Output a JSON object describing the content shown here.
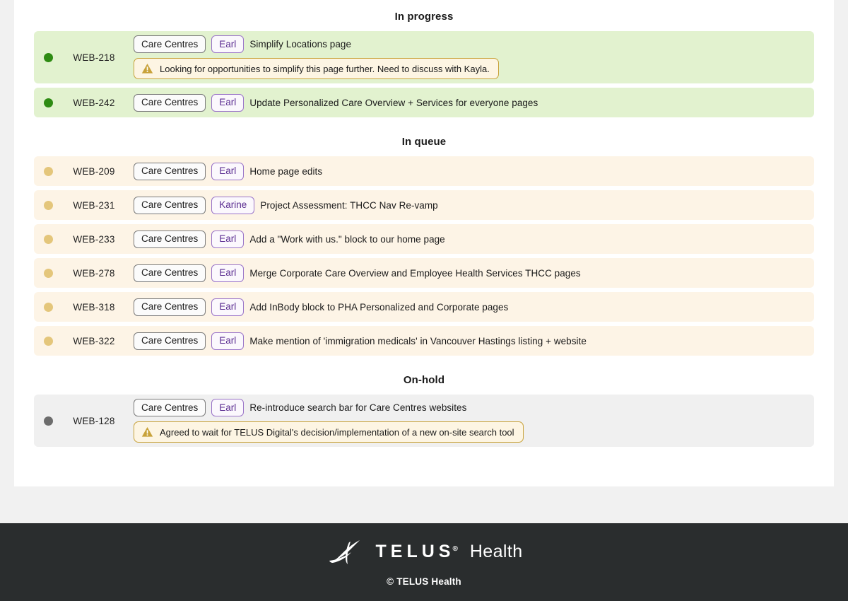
{
  "sections": [
    {
      "id": "in-progress",
      "header": "In progress",
      "status_color": "#2e8b13",
      "row_bg": "#e2f2cf",
      "tasks": [
        {
          "id": "WEB-218",
          "project": "Care Centres",
          "owner": "Earl",
          "title": "Simplify Locations page",
          "note": "Looking for opportunities to simplify this page further.  Need to discuss with Kayla."
        },
        {
          "id": "WEB-242",
          "project": "Care Centres",
          "owner": "Earl",
          "title": "Update Personalized Care Overview + Services for everyone pages",
          "note": ""
        }
      ]
    },
    {
      "id": "in-queue",
      "header": "In queue",
      "status_color": "#e4c67b",
      "row_bg": "#fdf4e6",
      "tasks": [
        {
          "id": "WEB-209",
          "project": "Care Centres",
          "owner": "Earl",
          "title": "Home page edits",
          "note": ""
        },
        {
          "id": "WEB-231",
          "project": "Care Centres",
          "owner": "Karine",
          "title": "Project Assessment: THCC Nav Re-vamp",
          "note": ""
        },
        {
          "id": "WEB-233",
          "project": "Care Centres",
          "owner": "Earl",
          "title": "Add a \"Work with us.\" block to our home page",
          "note": ""
        },
        {
          "id": "WEB-278",
          "project": "Care Centres",
          "owner": "Earl",
          "title": "Merge Corporate Care Overview and Employee Health Services THCC pages",
          "note": ""
        },
        {
          "id": "WEB-318",
          "project": "Care Centres",
          "owner": "Earl",
          "title": "Add InBody block to PHA Personalized and Corporate pages",
          "note": ""
        },
        {
          "id": "WEB-322",
          "project": "Care Centres",
          "owner": "Earl",
          "title": "Make mention of 'immigration medicals' in Vancouver Hastings listing + website",
          "note": ""
        }
      ]
    },
    {
      "id": "on-hold",
      "header": "On-hold",
      "status_color": "#6c6c6c",
      "row_bg": "#f0f0f0",
      "tasks": [
        {
          "id": "WEB-128",
          "project": "Care Centres",
          "owner": "Earl",
          "title": "Re-introduce search bar for Care Centres websites",
          "note": "Agreed to wait for TELUS Digital's decision/implementation of a new on-site search tool"
        }
      ]
    }
  ],
  "footer": {
    "brand_telus": "TELUS",
    "brand_registered": "®",
    "brand_health": "Health",
    "copyright": "© TELUS Health"
  },
  "colors": {
    "page_bg": "#f1f1f1",
    "card_bg": "#ffffff",
    "footer_bg": "#2a2d2e",
    "note_border": "#c8a23a",
    "note_bg": "#fdf5e3",
    "owner_chip_border": "#9a74c8",
    "owner_chip_text": "#5b2d91",
    "project_chip_border": "#7a7a7a"
  }
}
